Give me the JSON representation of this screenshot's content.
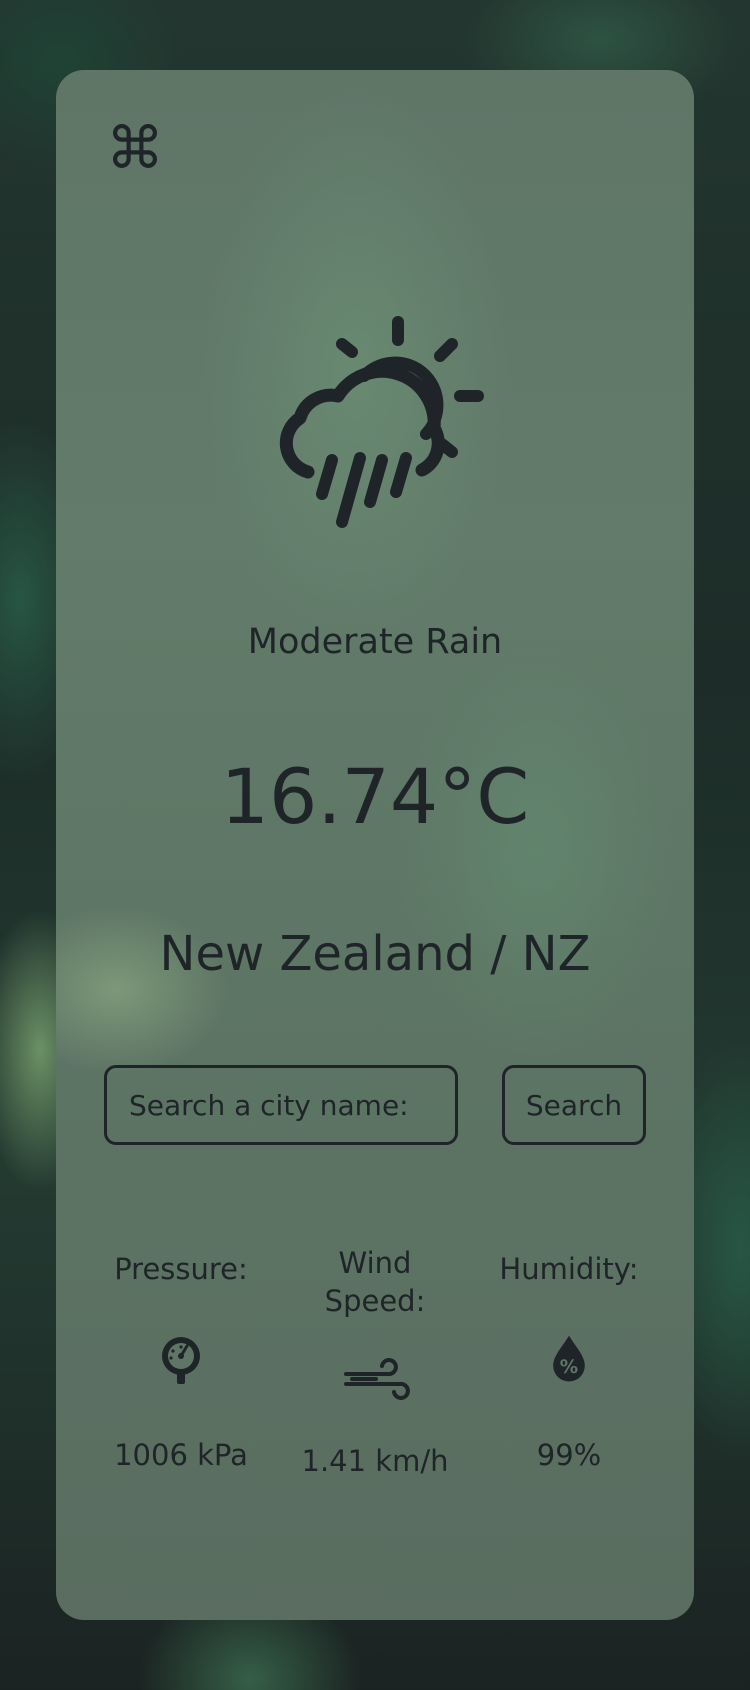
{
  "app": {
    "logo_icon": "command-icon",
    "logo_glyph": "⌘"
  },
  "weather": {
    "icon": "cloud-sun-rain-icon",
    "condition": "Moderate Rain",
    "temperature": "16.74°C",
    "location": "New Zealand / NZ"
  },
  "search": {
    "placeholder": "Search a city name:",
    "value": "",
    "button_label": "Search"
  },
  "stats": {
    "pressure": {
      "label": "Pressure:",
      "icon": "gauge-icon",
      "value": "1006 kPa"
    },
    "wind": {
      "label_line1": "Wind",
      "label_line2": "Speed:",
      "icon": "wind-icon",
      "value": "1.41 km/h"
    },
    "humidity": {
      "label": "Humidity:",
      "icon": "humidity-drop-icon",
      "value": "99%"
    }
  },
  "colors": {
    "text": "#1f2429",
    "card": "#5f7667",
    "background": "#1c2826"
  }
}
